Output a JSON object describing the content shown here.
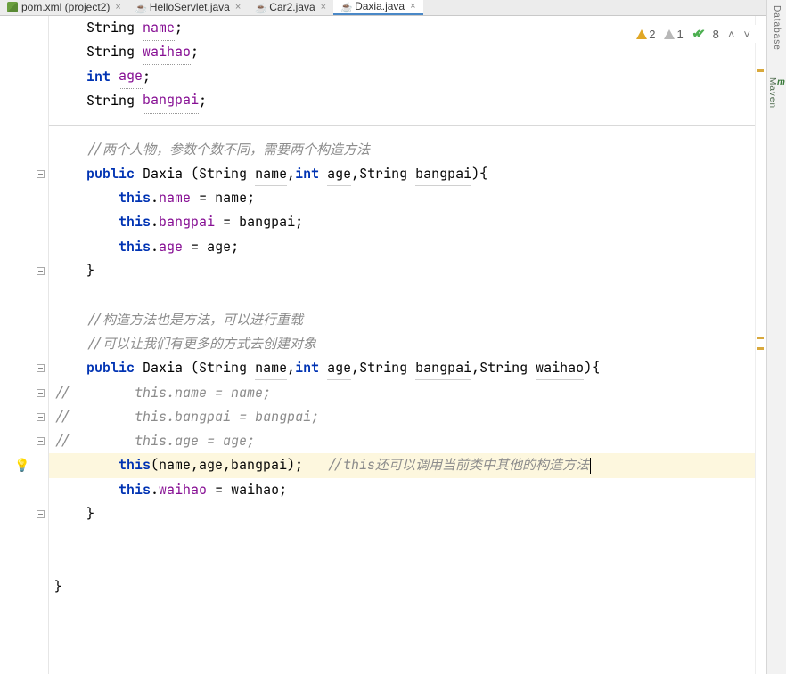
{
  "tabs": [
    {
      "label": "pom.xml (project2)",
      "icon": "xml",
      "active": false
    },
    {
      "label": "HelloServlet.java",
      "icon": "java",
      "active": false
    },
    {
      "label": "Car2.java",
      "icon": "java",
      "active": false
    },
    {
      "label": "Daxia.java",
      "icon": "java",
      "active": true
    }
  ],
  "inspection": {
    "warn": "2",
    "weak": "1",
    "ok": "8"
  },
  "side_tools": {
    "database": "Database",
    "maven": "Maven"
  },
  "code": {
    "l0": {
      "ind": "    ",
      "t1": "String ",
      "t2": "name",
      "t3": ";"
    },
    "l1": {
      "ind": "    ",
      "t1": "String ",
      "t2": "waihao",
      "t3": ";"
    },
    "l2": {
      "ind": "    ",
      "t1": "int ",
      "t2": "age",
      "t3": ";"
    },
    "l3": {
      "ind": "    ",
      "t1": "String ",
      "t2": "bangpai",
      "t3": ";"
    },
    "l5": {
      "ind": "    ",
      "t": "//两个人物，参数个数不同，需要两个构造方法"
    },
    "l6": {
      "ind": "    ",
      "pub": "public ",
      "cls": "Daxia ",
      "open": "(String ",
      "p1": "name",
      "c1": ",",
      "int": "int ",
      "p2": "age",
      "c2": ",String ",
      "p3": "bangpai",
      "close": "){"
    },
    "l7": {
      "ind": "        ",
      "t1": "this",
      "dot": ".",
      "f": "name",
      "eq": " = name;"
    },
    "l8": {
      "ind": "        ",
      "t1": "this",
      "dot": ".",
      "f": "bangpai",
      "eq": " = bangpai;"
    },
    "l9": {
      "ind": "        ",
      "t1": "this",
      "dot": ".",
      "f": "age",
      "eq": " = age;"
    },
    "l10": {
      "ind": "    ",
      "t": "}"
    },
    "l12": {
      "ind": "    ",
      "t": "//构造方法也是方法，可以进行重载"
    },
    "l13": {
      "ind": "    ",
      "t": "//可以让我们有更多的方式去创建对象"
    },
    "l14": {
      "ind": "    ",
      "pub": "public ",
      "cls": "Daxia ",
      "open": "(String ",
      "p1": "name",
      "c1": ",",
      "int": "int ",
      "p2": "age",
      "c2": ",String ",
      "p3": "bangpai",
      "c3": ",String ",
      "p4": "waihao",
      "close": "){"
    },
    "l15": {
      "sl": "//",
      "ind": "        ",
      "t": "this.name = name;"
    },
    "l16": {
      "sl": "//",
      "ind": "        ",
      "t": "this.",
      "u": "bangpai",
      "t2": " = ",
      "u2": "bangpai",
      "t3": ";"
    },
    "l17": {
      "sl": "//",
      "ind": "        ",
      "t": "this.age = age;"
    },
    "l18": {
      "ind": "        ",
      "t1": "this",
      "args": "(name,age,bangpai);   ",
      "cmt": "//this还可以调用当前类中其他的构造方法"
    },
    "l19": {
      "ind": "        ",
      "t1": "this",
      "dot": ".",
      "f": "waihao",
      "eq": " = waihao;"
    },
    "l20": {
      "ind": "    ",
      "t": "}"
    },
    "l23": {
      "t": "}"
    }
  }
}
